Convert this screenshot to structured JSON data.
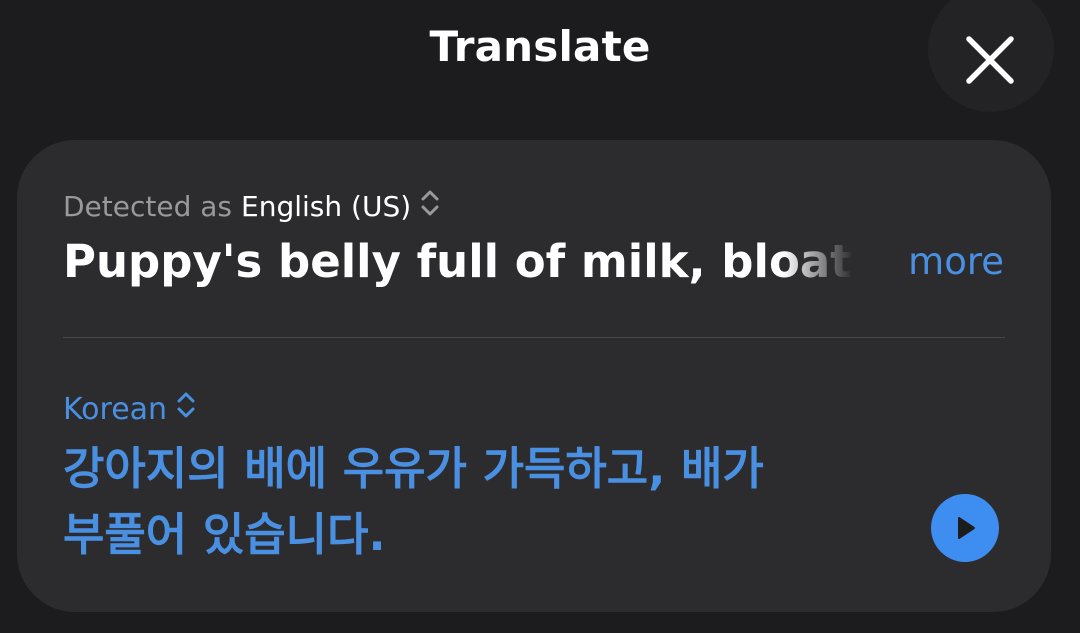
{
  "header": {
    "title": "Translate"
  },
  "icons": {
    "close": "close-icon",
    "source_chevron": "chevron-up-down-icon",
    "target_chevron": "chevron-up-down-icon",
    "play": "play-icon"
  },
  "source": {
    "detected_prefix": "Detected as",
    "language": "English (US)",
    "text": "Puppy's belly full of milk, bloated",
    "more_label": "more"
  },
  "target": {
    "language": "Korean",
    "text_line1": "강아지의 배에 우유가 가득하고, 배가",
    "text_line2": "부풀어 있습니다."
  },
  "colors": {
    "background": "#1c1c1e",
    "card": "#2c2c2e",
    "accent": "#4a90e2",
    "secondary_text": "#98989d"
  }
}
